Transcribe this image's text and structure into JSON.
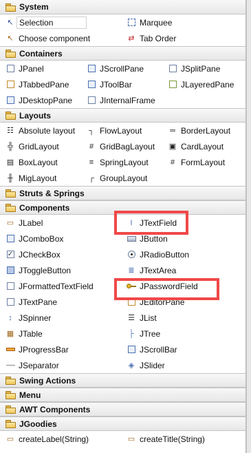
{
  "categories": {
    "system": "System",
    "containers": "Containers",
    "layouts": "Layouts",
    "struts": "Struts & Springs",
    "components": "Components",
    "swing_actions": "Swing Actions",
    "menu": "Menu",
    "awt": "AWT Components",
    "jgoodies": "JGoodies"
  },
  "system": {
    "selection": "Selection",
    "marquee": "Marquee",
    "choose_component": "Choose component",
    "tab_order": "Tab Order"
  },
  "containers": [
    "JPanel",
    "JScrollPane",
    "JSplitPane",
    "JTabbedPane",
    "JToolBar",
    "JLayeredPane",
    "JDesktopPane",
    "JInternalFrame"
  ],
  "layouts": [
    "Absolute layout",
    "FlowLayout",
    "BorderLayout",
    "GridLayout",
    "GridBagLayout",
    "CardLayout",
    "BoxLayout",
    "SpringLayout",
    "FormLayout",
    "MigLayout",
    "GroupLayout"
  ],
  "components": {
    "left": [
      "JLabel",
      "JComboBox",
      "JCheckBox",
      "JToggleButton",
      "JFormattedTextField",
      "JTextPane",
      "JSpinner",
      "JTable",
      "JProgressBar",
      "JSeparator"
    ],
    "right": [
      "JTextField",
      "JButton",
      "JRadioButton",
      "JTextArea",
      "JPasswordField",
      "JEditorPane",
      "JList",
      "JTree",
      "JScrollBar",
      "JSlider"
    ]
  },
  "jgoodies": [
    "createLabel(String)",
    "createTitle(String)"
  ],
  "highlight_color": "#f04848"
}
